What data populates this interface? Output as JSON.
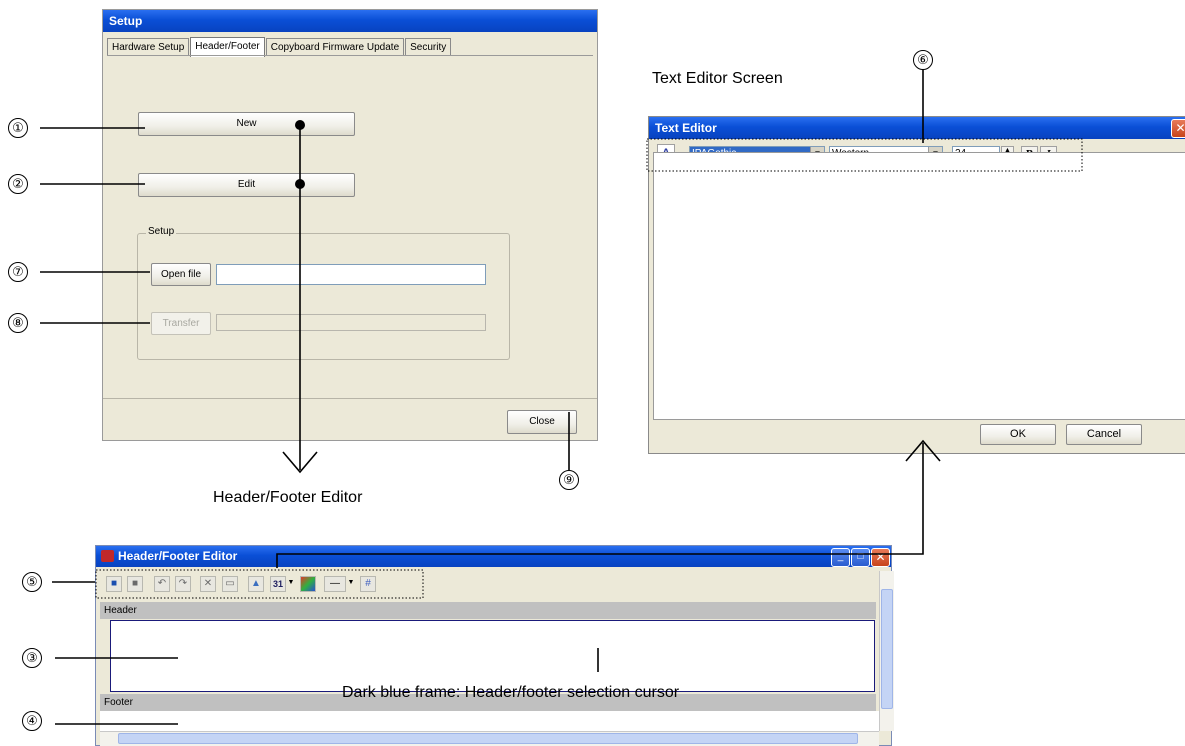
{
  "setup_window": {
    "title": "Setup",
    "tabs": [
      "Hardware Setup",
      "Header/Footer",
      "Copyboard Firmware Update",
      "Security"
    ],
    "new_label": "New",
    "edit_label": "Edit",
    "group_label": "Setup",
    "open_file_label": "Open file",
    "open_file_value": "",
    "transfer_label": "Transfer",
    "close_label": "Close"
  },
  "text_editor": {
    "caption": "Text Editor Screen",
    "title": "Text Editor",
    "font_icon": "A",
    "font_name": "IPAGothic",
    "script": "Western",
    "size": "24",
    "bold_label": "B",
    "italic_label": "I",
    "ok_label": "OK",
    "cancel_label": "Cancel"
  },
  "hf_editor": {
    "caption": "Header/Footer Editor",
    "title": "Header/Footer Editor",
    "header_label": "Header",
    "footer_label": "Footer",
    "calendar_day": "31",
    "selection_note": "Dark blue frame: Header/footer selection cursor"
  },
  "annotations": {
    "n1": "①",
    "n2": "②",
    "n3": "③",
    "n4": "④",
    "n5": "⑤",
    "n6": "⑥",
    "n7": "⑦",
    "n8": "⑧",
    "n9": "⑨"
  },
  "colors": {
    "title_blue": "#0a4fd6",
    "selection_frame": "#1a1a7a",
    "xp_face": "#ece9d8"
  }
}
